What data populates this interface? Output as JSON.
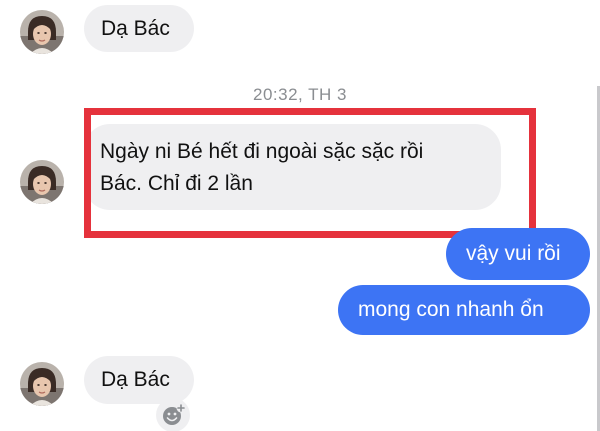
{
  "conversation": {
    "messages": [
      {
        "from": "contact",
        "text": "Dạ Bác"
      },
      {
        "from": "contact",
        "text_lines": [
          "Ngày ni Bé hết đi ngoài sặc sặc rồi",
          "Bác. Chỉ đi 2 lần"
        ]
      },
      {
        "from": "me",
        "text": "vậy vui rồi"
      },
      {
        "from": "me",
        "text": "mong con nhanh ổn"
      },
      {
        "from": "contact",
        "text": "Dạ Bác"
      }
    ],
    "timestamp": "20:32, TH 3"
  },
  "icons": {
    "avatar": "contact-avatar-icon",
    "reaction": "add-reaction-smiley-icon"
  },
  "colors": {
    "incoming_bubble": "#efeff1",
    "outgoing_bubble": "#3d74f4",
    "highlight_border": "#e5323c",
    "timestamp_text": "#8a8d91"
  }
}
